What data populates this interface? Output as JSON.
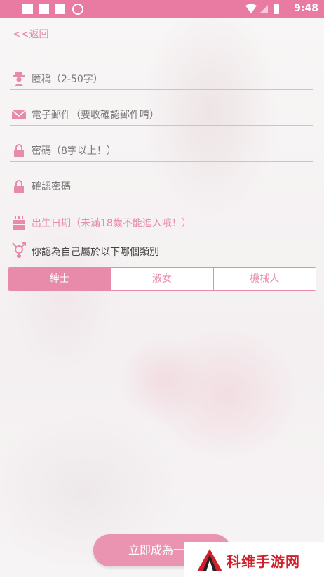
{
  "status_bar": {
    "time": "9:48"
  },
  "nav": {
    "back_label": "<<返回"
  },
  "form": {
    "nickname_placeholder": "匿稱（2-50字）",
    "email_placeholder": "電子郵件（要收確認郵件唷）",
    "password_placeholder": "密碼（8字以上！）",
    "confirm_password_placeholder": "確認密碼",
    "birthday_placeholder": "出生日期（未滿18歲不能進入哦！）",
    "gender_question": "你認為自己屬於以下哪個類別",
    "gender_options": [
      "紳士",
      "淑女",
      "機械人"
    ],
    "gender_selected": "紳士"
  },
  "cta": {
    "label": "立即成為一位"
  },
  "watermark": {
    "text": "科维手游网"
  },
  "colors": {
    "accent": "#e88aaa",
    "status_bar": "#e97aa1",
    "cta": "#ea94b2"
  }
}
